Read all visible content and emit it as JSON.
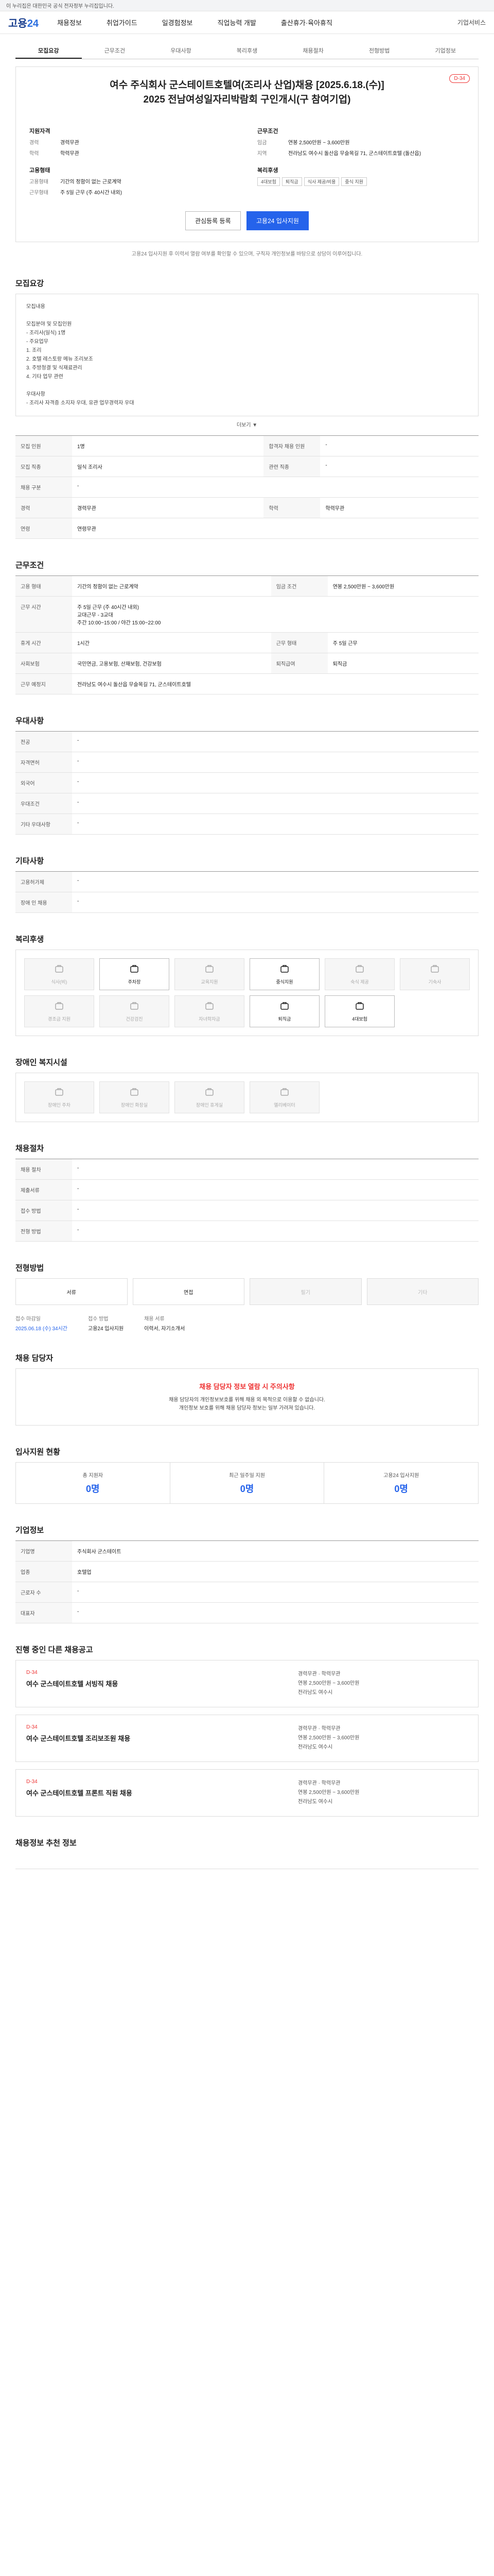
{
  "topbar": {
    "notice": "이 누리집은 대한민국 공식 전자정부 누리집입니다."
  },
  "gnb": {
    "logo_a": "고용",
    "logo_b": "24",
    "items": [
      "채용정보",
      "취업가이드",
      "일경험정보",
      "직업능력 개발",
      "출산휴가·육아휴직"
    ],
    "right": "기업서비스"
  },
  "tabs": [
    "모집요강",
    "근무조건",
    "우대사항",
    "복리후생",
    "채용절차",
    "전형방법",
    "기업정보"
  ],
  "job": {
    "dday": "D-34",
    "title": "여수 주식회사 군스테이트호텔여(조리사 산업)채용 [2025.6.18.(수)]\n2025 전남여성일자리박람회 구인개시(구 참여기업)",
    "company_h": "지원자격",
    "career_k": "경력",
    "career_v": "경력무관",
    "edu_k": "학력",
    "edu_v": "학력무관",
    "cond_h": "근무조건",
    "pay_k": "임금",
    "pay_v": "연봉 2,500만원 ~ 3,600만원",
    "loc_k": "지역",
    "loc_v": "전라남도 여수시 돌산읍 무슬목길 71, 군스테이트호텔 (돌산읍)",
    "type_h": "고용형태",
    "type_k": "고용형태",
    "type_v": "기간의 정함이 없는 근로계약",
    "hours_k": "근무형태",
    "hours_v": "주 5일 근무 (주 40시간 내외)",
    "welfare_h": "복리후생",
    "tags": [
      "4대보험",
      "퇴직금",
      "식사 제공/비용",
      "중식 지원"
    ]
  },
  "buttons": {
    "scrap": "관심등록 등록",
    "apply": "고용24 입사지원"
  },
  "notice": "고용24 입사지원 후 이력서 열람 여부를 확인할 수 있으며, 구직자 개인정보를 바탕으로 상담이 이루어집니다.",
  "s_recruit": {
    "h": "모집요강",
    "body": "모집내용\n\n모집분야 및 모집인원\n- 조리사(일식) 1명\n- 주요업무\n  1. 조리\n  2. 호텔 레스토랑 메뉴 조리보조\n  3. 주방청결 및 식재료관리\n  4. 기타 업무 관련\n\n우대사항\n- 조리사 자격증 소지자 우대, 유관 업무경력자 우대",
    "more": "더보기 ▼"
  },
  "recruit_table": [
    [
      "모집 인원",
      "1명",
      "합격자 채용 인원",
      "-"
    ],
    [
      "모집 직종",
      "일식 조리사",
      "관련 직종",
      "-"
    ],
    [
      "채용 구분",
      "-",
      "",
      ""
    ],
    [
      "경력",
      "경력무관",
      "학력",
      "학력무관"
    ],
    [
      "연령",
      "연령무관",
      "",
      ""
    ]
  ],
  "s_cond": {
    "h": "근무조건"
  },
  "cond_table": [
    [
      "고용 형태",
      "기간의 정함이 없는 근로계약",
      "임금 조건",
      "연봉 2,500만원 ~ 3,600만원"
    ],
    [
      "근무 시간",
      "주 5일 근무 (주 40시간 내외)\n교대근무 - 3교대\n주간 10:00~15:00 / 야간 15:00~22:00",
      "",
      ""
    ],
    [
      "휴게 시간",
      "1시간",
      "근무 형태",
      "주 5일 근무"
    ],
    [
      "사회보험",
      "국민연금, 고용보험, 산재보험, 건강보험",
      "퇴직급여",
      "퇴직금"
    ],
    [
      "근무 예정지",
      "전라남도 여수시 돌산읍 무슬목길 71, 군스테이트호텔",
      "",
      ""
    ]
  ],
  "s_pref": {
    "h": "우대사항"
  },
  "pref_table": [
    [
      "전공",
      "-"
    ],
    [
      "자격면허",
      "-"
    ],
    [
      "외국어",
      "-"
    ],
    [
      "우대조건",
      "-"
    ],
    [
      "기타 우대사항",
      "-"
    ]
  ],
  "s_etc": {
    "h": "기타사항"
  },
  "etc_table": [
    [
      "고용허가제",
      "-"
    ],
    [
      "장애 인 채용",
      "-"
    ]
  ],
  "s_welfare": {
    "h": "복리후생"
  },
  "welfare_icons": [
    {
      "label": "식사(비)",
      "on": false
    },
    {
      "label": "주차장",
      "on": true
    },
    {
      "label": "교육지원",
      "on": false
    },
    {
      "label": "중식지원",
      "on": true
    },
    {
      "label": "숙식 제공",
      "on": false
    },
    {
      "label": "기숙사",
      "on": false
    },
    {
      "label": "경조금 지원",
      "on": false
    },
    {
      "label": "건강검진",
      "on": false
    },
    {
      "label": "자녀학자금",
      "on": false
    },
    {
      "label": "퇴직금",
      "on": true
    },
    {
      "label": "4대보험",
      "on": true
    }
  ],
  "s_disability": {
    "h": "장애인 복지시설"
  },
  "dis_icons": [
    {
      "label": "장애인 주차",
      "on": false
    },
    {
      "label": "장애인 화장실",
      "on": false
    },
    {
      "label": "장애인 휴게실",
      "on": false
    },
    {
      "label": "엘리베이터",
      "on": false
    }
  ],
  "s_process": {
    "h": "채용절차"
  },
  "process_table": [
    [
      "채용 절차",
      "-"
    ],
    [
      "제출서류",
      "-"
    ],
    [
      "접수 방법",
      "-"
    ],
    [
      "전형 방법",
      "-"
    ]
  ],
  "s_method": {
    "h": "전형방법"
  },
  "methods": [
    {
      "label": "서류",
      "on": true
    },
    {
      "label": "면접",
      "on": true
    },
    {
      "label": "필기",
      "on": false
    },
    {
      "label": "기타",
      "on": false
    }
  ],
  "period": {
    "k1": "접수 마감일",
    "v1": "2025.06.18 (수) 34시간",
    "k2": "접수 방법",
    "v2": "고용24 입사지원",
    "k3": "채용 서류",
    "v3": "이력서, 자기소개서"
  },
  "s_warn": {
    "h": "채용 담당자",
    "title": "채용 담당자 정보 열람 시 주의사항",
    "body": "채용 담당자의 개인정보보호를 위해 채용 외 목적으로 이용할 수 없습니다.\n개인정보 보호를 위해 채용 담당자 정보는 일부 가려져 있습니다."
  },
  "s_status": {
    "h": "입사지원 현황"
  },
  "stats": [
    {
      "label": "총 지원자",
      "value": "0명"
    },
    {
      "label": "최근 일주일 지원",
      "value": "0명"
    },
    {
      "label": "고용24 입사지원",
      "value": "0명"
    }
  ],
  "s_company": {
    "h": "기업정보"
  },
  "company_table": [
    [
      "기업명",
      "주식회사 군스테이트"
    ],
    [
      "업종",
      "호텔업"
    ],
    [
      "근로자 수",
      "-"
    ],
    [
      "대표자",
      "-"
    ]
  ],
  "s_others": {
    "h": "진행 중인 다른 채용공고"
  },
  "others": [
    {
      "d": "D-34",
      "t": "여수 군스테이트호텔 서빙직 채용",
      "r": "경력무관 · 학력무관\n연봉 2,500만원 ~ 3,600만원\n전라남도 여수시"
    },
    {
      "d": "D-34",
      "t": "여수 군스테이트호텔 조리보조원 채용",
      "r": "경력무관 · 학력무관\n연봉 2,500만원 ~ 3,600만원\n전라남도 여수시"
    },
    {
      "d": "D-34",
      "t": "여수 군스테이트호텔 프론트 직원 채용",
      "r": "경력무관 · 학력무관\n연봉 2,500만원 ~ 3,600만원\n전라남도 여수시"
    }
  ],
  "footer": {
    "h": "채용정보 추천 정보"
  }
}
